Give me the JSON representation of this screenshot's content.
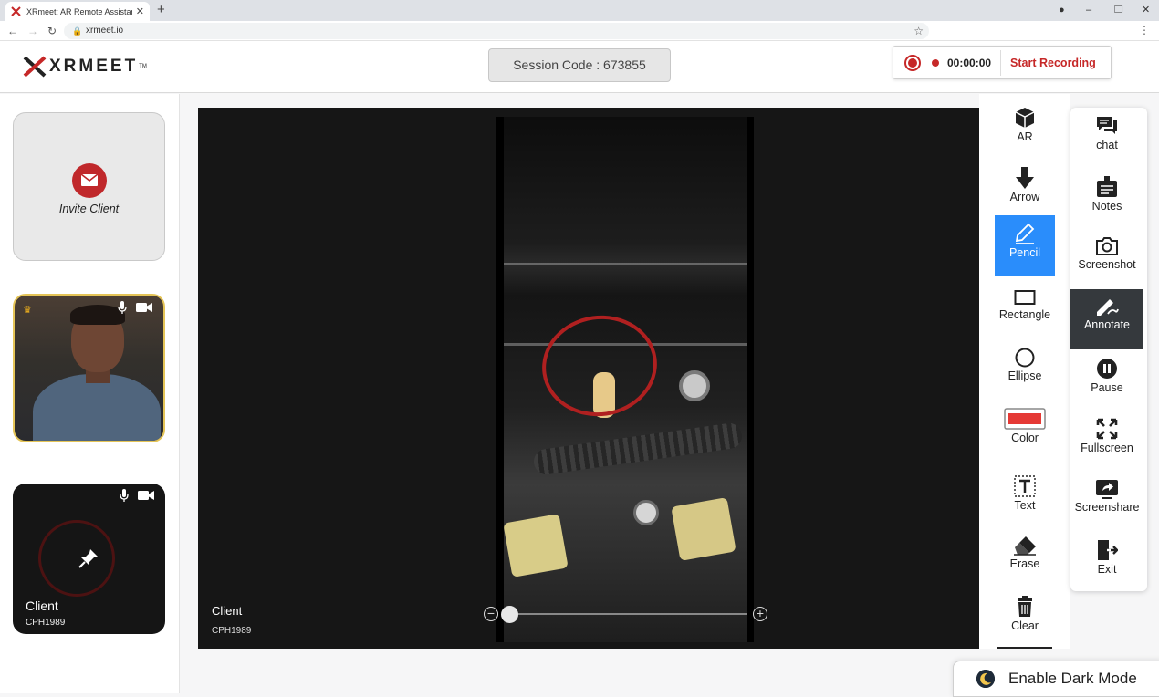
{
  "browser": {
    "tab_title": "XRmeet: AR Remote Assistance &",
    "url": "xrmeet.io"
  },
  "header": {
    "logo_text": "XRMEET",
    "logo_tm": "TM",
    "session_code": "Session Code : 673855",
    "timer": "00:00:00",
    "start_recording": "Start Recording",
    "accent_color": "#c62828"
  },
  "sidebar": {
    "invite_label": "Invite Client",
    "client_name": "Client",
    "client_id": "CPH1989"
  },
  "video": {
    "name": "Client",
    "id": "CPH1989",
    "zoom_level": 0
  },
  "tools": [
    {
      "label": "AR",
      "icon": "ar-cube-icon"
    },
    {
      "label": "Arrow",
      "icon": "arrow-down-icon"
    },
    {
      "label": "Pencil",
      "icon": "pencil-icon",
      "active": true
    },
    {
      "label": "Rectangle",
      "icon": "rectangle-icon"
    },
    {
      "label": "Ellipse",
      "icon": "ellipse-icon"
    },
    {
      "label": "Color",
      "icon": "color-swatch-icon",
      "swatch": "#e53935"
    },
    {
      "label": "Text",
      "icon": "text-icon"
    },
    {
      "label": "Erase",
      "icon": "eraser-icon"
    },
    {
      "label": "Clear",
      "icon": "trash-icon"
    }
  ],
  "actions": [
    {
      "label": "chat",
      "icon": "chat-icon"
    },
    {
      "label": "Notes",
      "icon": "notes-icon"
    },
    {
      "label": "Screenshot",
      "icon": "camera-icon"
    },
    {
      "label": "Annotate",
      "icon": "annotate-icon",
      "active": true
    },
    {
      "label": "Pause",
      "icon": "pause-icon"
    },
    {
      "label": "Fullscreen",
      "icon": "fullscreen-icon"
    },
    {
      "label": "Screenshare",
      "icon": "screenshare-icon"
    },
    {
      "label": "Exit",
      "icon": "exit-icon"
    }
  ],
  "dark_mode_label": "Enable Dark Mode",
  "active_tool_color": "#2a8dfb"
}
